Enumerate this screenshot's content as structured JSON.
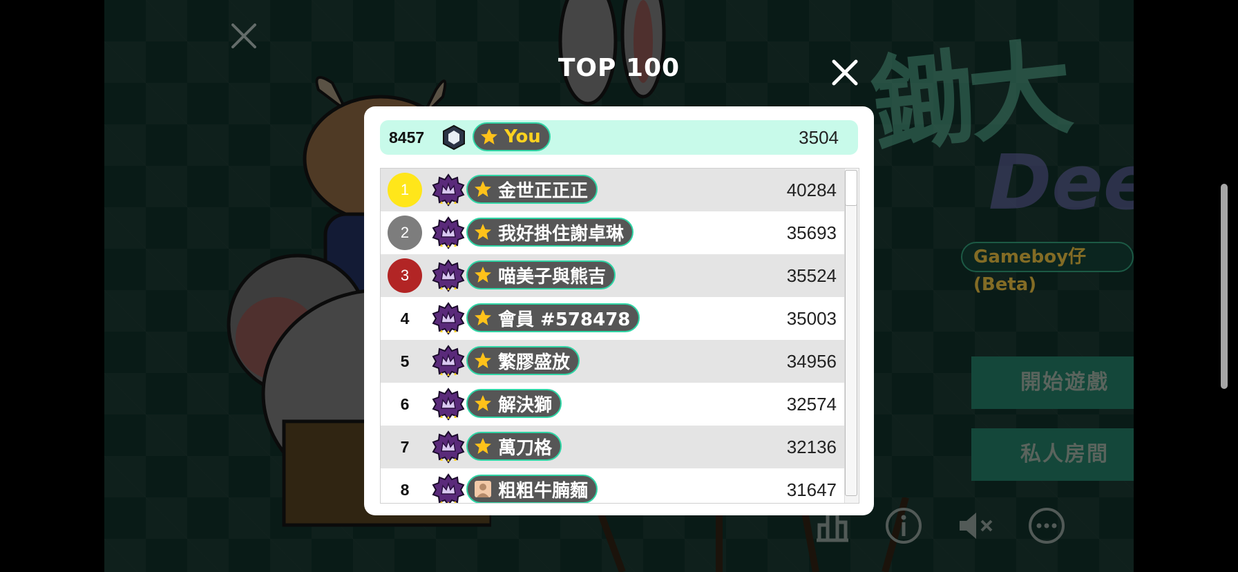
{
  "background": {
    "logo_chars": "鋤大",
    "logo_sub": "Dee",
    "subtitle": "Gameboy仔(Beta)",
    "menu": [
      {
        "label": "開始遊戲"
      },
      {
        "label": "私人房間"
      }
    ],
    "bottom_icons": [
      "leaderboard-icon",
      "info-icon",
      "sound-muted-icon",
      "more-icon"
    ]
  },
  "modal": {
    "title": "TOP 100",
    "you": {
      "rank": "8457",
      "name": "You",
      "score": "3504",
      "badge_icon": "crystal-badge-icon"
    },
    "rows": [
      {
        "rank": "1",
        "name": "金世正正正",
        "score": "40284",
        "icon": "star-icon",
        "rank_color": "#ffe61a"
      },
      {
        "rank": "2",
        "name": "我好掛住謝卓琳",
        "score": "35693",
        "icon": "star-icon",
        "rank_color": "#7d7d7d"
      },
      {
        "rank": "3",
        "name": "喵美子與熊吉",
        "score": "35524",
        "icon": "star-icon",
        "rank_color": "#b22525"
      },
      {
        "rank": "4",
        "name": "會員 #578478",
        "score": "35003",
        "icon": "star-icon"
      },
      {
        "rank": "5",
        "name": "繁膠盛放",
        "score": "34956",
        "icon": "star-icon"
      },
      {
        "rank": "6",
        "name": "解決獅",
        "score": "32574",
        "icon": "star-icon"
      },
      {
        "rank": "7",
        "name": "萬刀格",
        "score": "32136",
        "icon": "star-icon"
      },
      {
        "rank": "8",
        "name": "粗粗牛腩麵",
        "score": "31647",
        "icon": "person-icon"
      }
    ]
  },
  "colors": {
    "accent_green": "#2fd5a5",
    "you_row_bg": "#c8faea",
    "pill_bg": "#565656",
    "star": "#ffc21a"
  }
}
